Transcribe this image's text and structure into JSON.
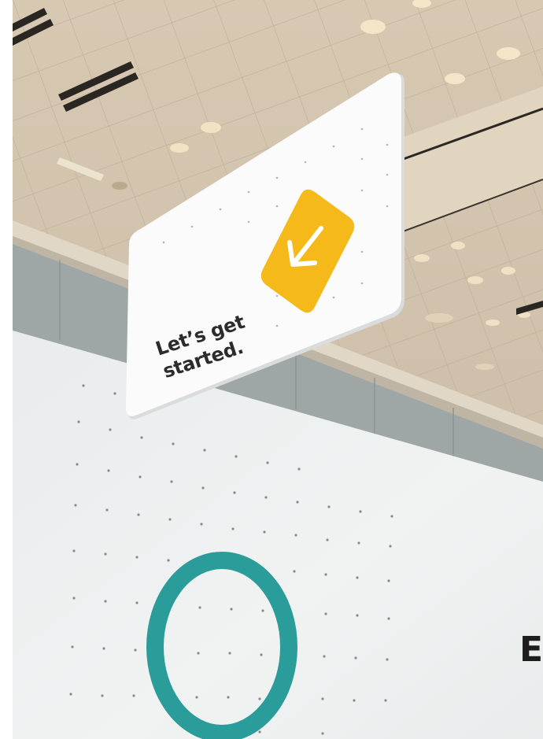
{
  "sign": {
    "line1": "Let’s get",
    "line2": "started.",
    "icon": "arrow-down-left-icon",
    "icon_color": "#f5b919"
  },
  "wall": {
    "text": "Ex",
    "ring_color": "#2a9c99"
  },
  "colors": {
    "ceiling": "#d8cbb8",
    "wall": "#edf0ef",
    "sign": "#fbfbfb"
  }
}
